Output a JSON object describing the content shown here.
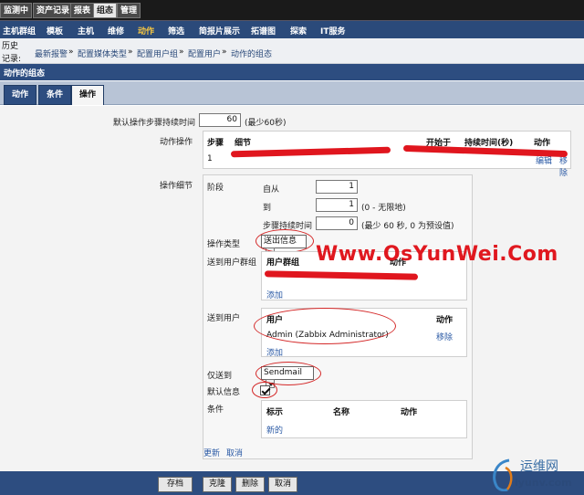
{
  "top_tabs": [
    "监测中",
    "资产记录",
    "报表",
    "组态",
    "管理"
  ],
  "nav2": [
    "主机群组",
    "模板",
    "主机",
    "维修",
    "动作",
    "筛选",
    "简报片展示",
    "拓谱图",
    "探索",
    "IT服务"
  ],
  "breadcrumb": {
    "history_label": "历史记录:",
    "items": [
      "最新报警",
      "配置媒体类型",
      "配置用户组",
      "配置用户",
      "动作的组态"
    ],
    "sep": "»"
  },
  "section_title": "动作的组态",
  "tabs": [
    "动作",
    "条件",
    "操作"
  ],
  "form": {
    "default_step_label": "默认操作步骤持续时间",
    "default_step_value": "60",
    "default_step_hint": "(最少60秒)",
    "action_ops_label": "动作操作",
    "ops_table_headers": [
      "步骤",
      "细节",
      "开始于",
      "持续时间(秒)",
      "动作"
    ],
    "ops_row_step": "1",
    "ops_row_links": [
      "编辑",
      "移除"
    ],
    "op_details_label": "操作细节",
    "stage_label": "阶段",
    "from_label": "自从",
    "from_value": "1",
    "to_label": "到",
    "to_value": "1",
    "to_hint": "(0 - 无限地)",
    "step_duration_label": "步骤持续时间",
    "step_duration_value": "0",
    "step_duration_hint": "(最少 60 秒, 0 为预设值)",
    "op_type_label": "操作类型",
    "op_type_value": "送出信息",
    "send_groups_label": "送到用户群组",
    "group_headers": [
      "用户群组",
      "动作"
    ],
    "add_label": "添加",
    "send_users_label": "送到用户",
    "user_headers": [
      "用户",
      "动作"
    ],
    "user_name": "Admin (Zabbix Administrator)",
    "remove_label": "移除",
    "send_only_label": "仅送到",
    "send_only_value": "Sendmail",
    "default_msg_label": "默认信息",
    "conditions_label": "条件",
    "cond_headers": [
      "标示",
      "名称",
      "动作"
    ],
    "new_label": "新的",
    "update_label": "更新",
    "cancel_label": "取消"
  },
  "footer_buttons": [
    "存档",
    "克隆",
    "删除",
    "取消"
  ],
  "watermark": "Www.OsYunWei.Com",
  "logo_text": "运维网",
  "logo_sub": "iyunv.com",
  "accent_color": "#2d4d80",
  "annotation_color": "#d42828"
}
